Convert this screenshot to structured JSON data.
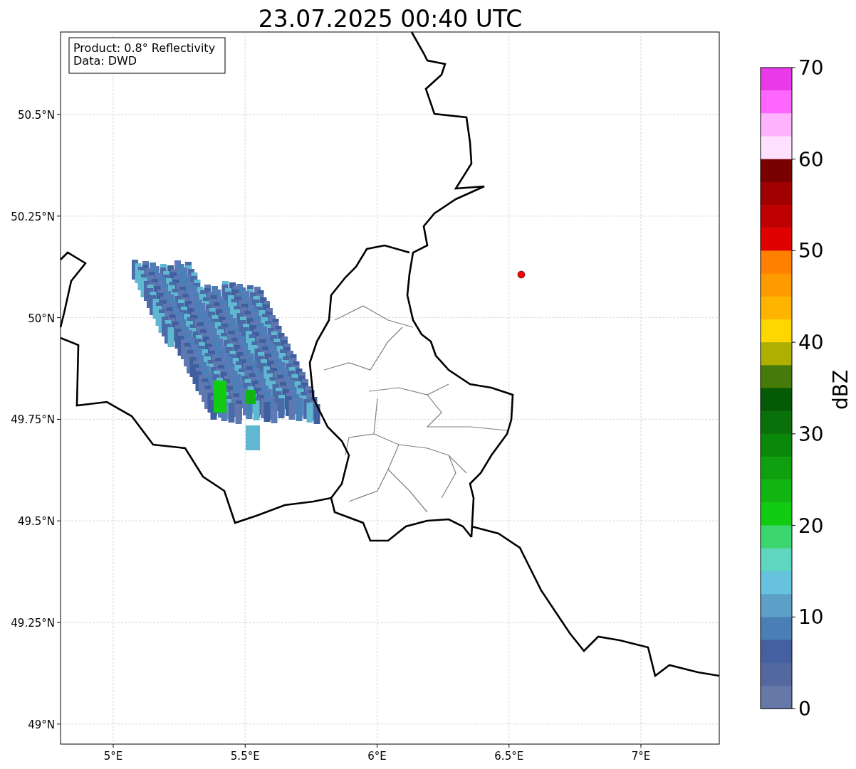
{
  "title": "23.07.2025 00:40 UTC",
  "legend": [
    "Product: 0.8° Reflectivity",
    "Data: DWD"
  ],
  "map": {
    "lat_ticks": [
      "50.5°N",
      "50.25°N",
      "50°N",
      "49.75°N",
      "49.5°N",
      "49.25°N",
      "49°N"
    ],
    "lon_ticks": [
      "5°E",
      "5.5°E",
      "6°E",
      "6.5°E",
      "7°E"
    ]
  },
  "colorbar": {
    "label": "dBZ",
    "ticks": [
      "70",
      "60",
      "50",
      "40",
      "30",
      "20",
      "10",
      "0"
    ],
    "levels": [
      {
        "color": "#e83ae8"
      },
      {
        "color": "#ff66ff"
      },
      {
        "color": "#ffb3ff"
      },
      {
        "color": "#ffe0ff"
      },
      {
        "color": "#780000"
      },
      {
        "color": "#a00000"
      },
      {
        "color": "#c00000"
      },
      {
        "color": "#e00000"
      },
      {
        "color": "#ff8000"
      },
      {
        "color": "#ff9a00"
      },
      {
        "color": "#ffb400"
      },
      {
        "color": "#ffd700"
      },
      {
        "color": "#afaf00"
      },
      {
        "color": "#467a0a"
      },
      {
        "color": "#055a05"
      },
      {
        "color": "#0a700a"
      },
      {
        "color": "#0a880a"
      },
      {
        "color": "#0fa00f"
      },
      {
        "color": "#11b511"
      },
      {
        "color": "#11cc11"
      },
      {
        "color": "#3cd66e"
      },
      {
        "color": "#5fd6c0"
      },
      {
        "color": "#66c2dd"
      },
      {
        "color": "#5ca0c8"
      },
      {
        "color": "#4a7fb5"
      },
      {
        "color": "#4460a0"
      },
      {
        "color": "#5468a0"
      },
      {
        "color": "#6678a8"
      }
    ]
  }
}
